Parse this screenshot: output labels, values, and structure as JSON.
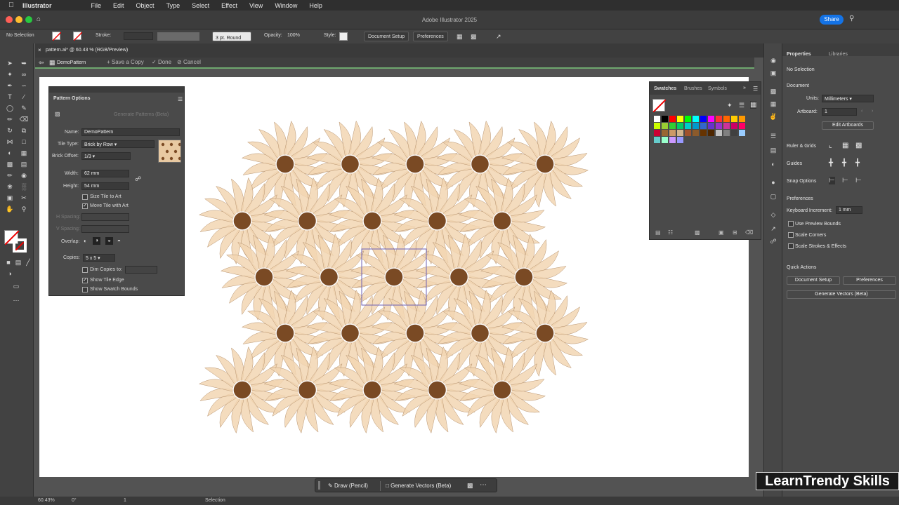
{
  "menubar": {
    "app_name": "Illustrator",
    "items": [
      "File",
      "Edit",
      "Object",
      "Type",
      "Select",
      "Effect",
      "View",
      "Window",
      "Help"
    ]
  },
  "titlebar": {
    "title": "Adobe Illustrator 2025",
    "share_label": "Share"
  },
  "controlbar": {
    "selection": "No Selection",
    "stroke_label": "Stroke:",
    "brush": "3 pt. Round",
    "opacity_label": "Opacity:",
    "opacity_value": "100%",
    "style_label": "Style:",
    "document_setup": "Document Setup",
    "preferences": "Preferences"
  },
  "doc_tab": {
    "label": "pattern.ai* @ 60.43 % (RGB/Preview)"
  },
  "pattern_bar": {
    "name": "DemoPattern",
    "save_copy": "Save a Copy",
    "done": "Done",
    "cancel": "Cancel"
  },
  "pattern_options": {
    "title": "Pattern Options",
    "generate_label": "Generate Patterns (Beta)",
    "name_label": "Name:",
    "name_value": "DemoPattern",
    "tile_type_label": "Tile Type:",
    "tile_type_value": "Brick by Row",
    "brick_offset_label": "Brick Offset:",
    "brick_offset_value": "1/3",
    "width_label": "Width:",
    "width_value": "62 mm",
    "height_label": "Height:",
    "height_value": "54 mm",
    "size_tile": "Size Tile to Art",
    "move_tile": "Move Tile with Art",
    "h_spacing": "H Spacing:",
    "v_spacing": "V Spacing:",
    "overlap_label": "Overlap:",
    "copies_label": "Copies:",
    "copies_value": "5 x 5",
    "dim_copies": "Dim Copies to:",
    "show_tile_edge": "Show Tile Edge",
    "show_swatch_bounds": "Show Swatch Bounds",
    "size_tile_checked": false,
    "move_tile_checked": true,
    "dim_copies_checked": false,
    "show_tile_edge_checked": true,
    "show_swatch_bounds_checked": false
  },
  "swatches_panel": {
    "tabs": [
      "Swatches",
      "Brushes",
      "Symbols"
    ],
    "colors": [
      "#ffffff",
      "#000000",
      "#ff0000",
      "#ffff00",
      "#00ff00",
      "#00ffff",
      "#0000ff",
      "#ff00ff",
      "#ff3333",
      "#ff6600",
      "#ffcc00",
      "#ff9900",
      "#ccff00",
      "#99cc33",
      "#33cc33",
      "#00cc66",
      "#00cccc",
      "#0099cc",
      "#3366cc",
      "#6633cc",
      "#9933cc",
      "#cc3399",
      "#cc0066",
      "#ff0066",
      "#cc0033",
      "#996633",
      "#cc9966",
      "#d2b48c",
      "#a0522d",
      "#8b5a2b",
      "#663300",
      "#4d2600",
      "#c0c0c0",
      "#808080",
      "#404040",
      "#99ccff",
      "#66cccc",
      "#99ffcc",
      "#cc99ff",
      "#9999ff"
    ]
  },
  "properties": {
    "tabs": [
      "Properties",
      "Libraries"
    ],
    "no_selection": "No Selection",
    "document_label": "Document",
    "units_label": "Units:",
    "units_value": "Millimeters",
    "artboard_label": "Artboard:",
    "artboard_value": "1",
    "edit_artboards": "Edit Artboards",
    "ruler_grids": "Ruler & Grids",
    "guides": "Guides",
    "snap_options": "Snap Options",
    "preferences_label": "Preferences",
    "keyboard_increment_label": "Keyboard Increment:",
    "keyboard_increment_value": "1 mm",
    "use_preview_bounds": "Use Preview Bounds",
    "scale_corners": "Scale Corners",
    "scale_strokes": "Scale Strokes & Effects",
    "quick_actions": "Quick Actions",
    "document_setup": "Document Setup",
    "preferences_btn": "Preferences",
    "generate_vectors": "Generate Vectors (Beta)"
  },
  "bottom_bar": {
    "draw": "Draw (Pencil)",
    "generate": "Generate Vectors (Beta)"
  },
  "statusbar": {
    "zoom": "60.43%",
    "rotation": "0°",
    "artboard": "1",
    "mode": "Selection"
  },
  "watermark": "LearnTrendy Skills",
  "flower": {
    "petal_color": "#f2d6b3",
    "petal_stroke": "#b89470",
    "center_color": "#7a4a24",
    "tile_outline": "#6b5fb5"
  }
}
